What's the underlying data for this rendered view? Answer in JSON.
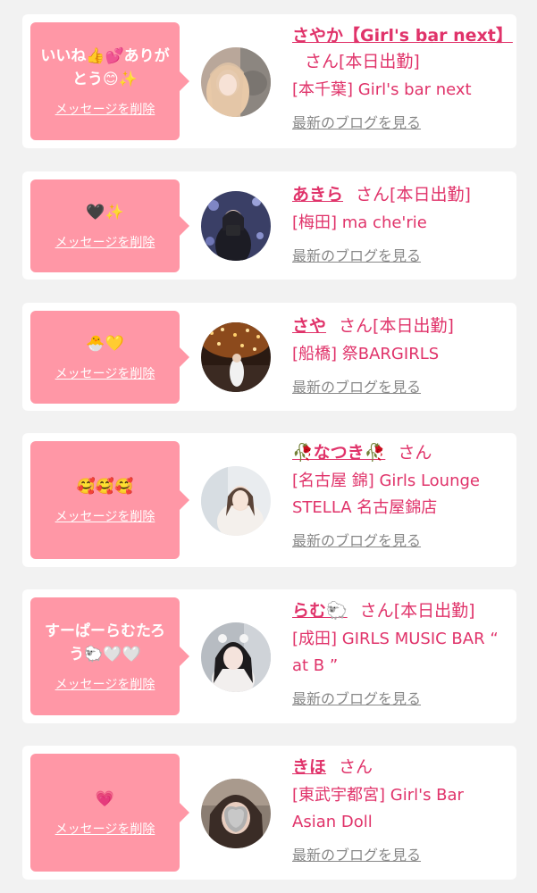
{
  "cards": [
    {
      "message": "いいね👍💕ありがとう😊✨",
      "delete_label": "メッセージを削除",
      "name": "さやか【Girl's bar next】",
      "san": "さん",
      "status": "[本日出勤]",
      "shop": "[本千葉] Girl's bar next",
      "blog_label": "最新のブログを見る"
    },
    {
      "message": "🖤✨",
      "delete_label": "メッセージを削除",
      "name": "あきら",
      "san": "さん",
      "status": "[本日出勤]",
      "shop": "[梅田] ma che'rie",
      "blog_label": "最新のブログを見る"
    },
    {
      "message": "🐣💛",
      "delete_label": "メッセージを削除",
      "name": "さや",
      "san": "さん",
      "status": "[本日出勤]",
      "shop": "[船橋] 祭BARGIRLS",
      "blog_label": "最新のブログを見る"
    },
    {
      "message": "🥰🥰🥰",
      "delete_label": "メッセージを削除",
      "name": "🥀なつき🥀",
      "san": "さん",
      "status": "",
      "shop": "[名古屋 錦] Girls Lounge STELLA 名古屋錦店",
      "blog_label": "最新のブログを見る"
    },
    {
      "message": "すーぱーらむたろう🐑🤍🤍",
      "delete_label": "メッセージを削除",
      "name": "らむ🐑",
      "san": "さん",
      "status": "[本日出勤]",
      "shop": "[成田] GIRLS MUSIC BAR “ at B ”",
      "blog_label": "最新のブログを見る"
    },
    {
      "message": "💗",
      "delete_label": "メッセージを削除",
      "name": "きほ",
      "san": "さん",
      "status": "",
      "shop": "[東武宇都宮] Girl's Bar Asian Doll",
      "blog_label": "最新のブログを見る"
    }
  ],
  "colors": {
    "bubble": "#ff97a6",
    "accent": "#e0336a",
    "link_gray": "#888888",
    "background": "#f2f2f2"
  }
}
